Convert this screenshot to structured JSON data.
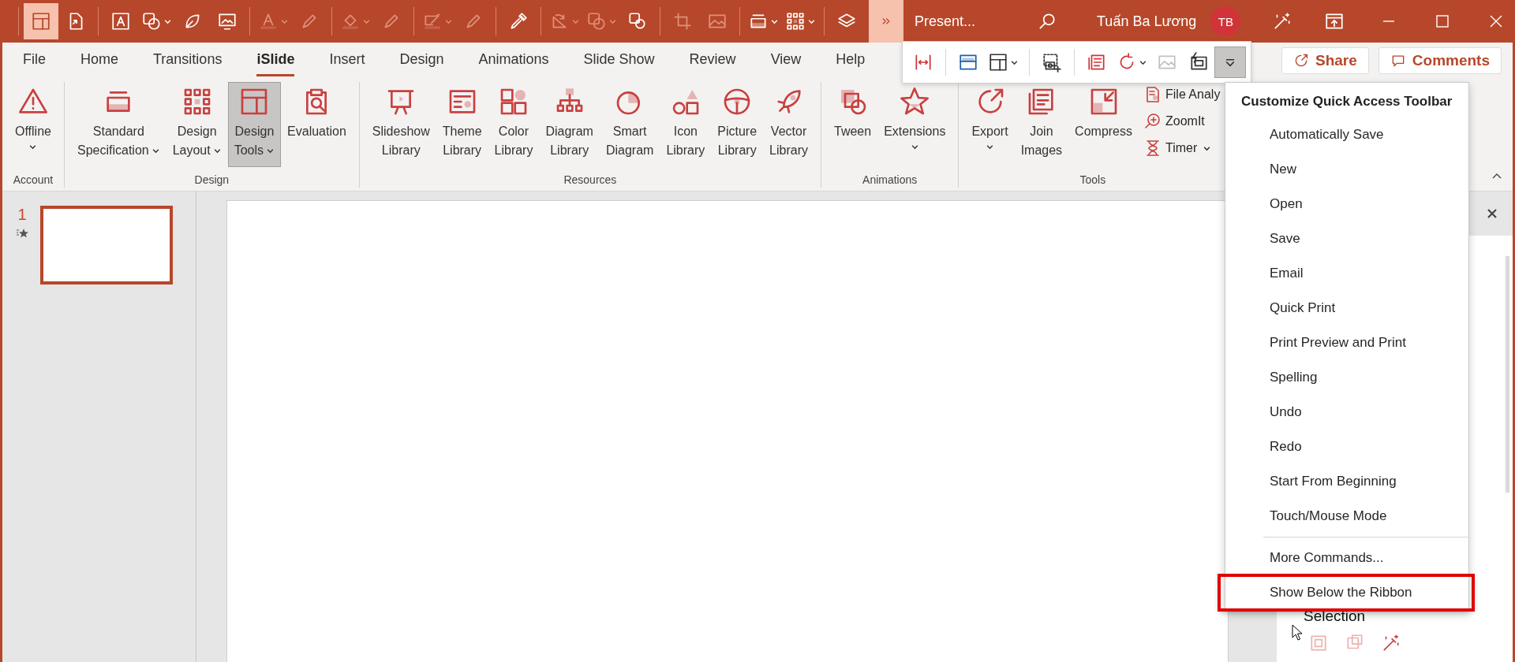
{
  "quick_access_toolbar": [
    {
      "kind": "separator"
    },
    {
      "kind": "button",
      "pressed": true,
      "disabled": false,
      "dropdown": false
    },
    {
      "kind": "button",
      "pressed": false,
      "disabled": false,
      "dropdown": false
    },
    {
      "kind": "separator"
    },
    {
      "kind": "button",
      "pressed": false,
      "disabled": false,
      "dropdown": false
    },
    {
      "kind": "button",
      "pressed": false,
      "disabled": false,
      "dropdown": true
    },
    {
      "kind": "button",
      "pressed": false,
      "disabled": false,
      "dropdown": false
    },
    {
      "kind": "button",
      "pressed": false,
      "disabled": false,
      "dropdown": false
    },
    {
      "kind": "separator"
    },
    {
      "kind": "button",
      "pressed": false,
      "disabled": true,
      "dropdown": true
    },
    {
      "kind": "button",
      "pressed": false,
      "disabled": true,
      "dropdown": false
    },
    {
      "kind": "separator"
    },
    {
      "kind": "button",
      "pressed": false,
      "disabled": true,
      "dropdown": true
    },
    {
      "kind": "button",
      "pressed": false,
      "disabled": true,
      "dropdown": false
    },
    {
      "kind": "separator"
    },
    {
      "kind": "button",
      "pressed": false,
      "disabled": true,
      "dropdown": true
    },
    {
      "kind": "button",
      "pressed": false,
      "disabled": true,
      "dropdown": false
    },
    {
      "kind": "separator"
    },
    {
      "kind": "button",
      "pressed": false,
      "disabled": false,
      "dropdown": false
    },
    {
      "kind": "separator"
    },
    {
      "kind": "button",
      "pressed": false,
      "disabled": true,
      "dropdown": true
    },
    {
      "kind": "button",
      "pressed": false,
      "disabled": true,
      "dropdown": true
    },
    {
      "kind": "button",
      "pressed": false,
      "disabled": false,
      "dropdown": false
    },
    {
      "kind": "separator"
    },
    {
      "kind": "button",
      "pressed": false,
      "disabled": true,
      "dropdown": false
    },
    {
      "kind": "button",
      "pressed": false,
      "disabled": true,
      "dropdown": false
    },
    {
      "kind": "separator"
    },
    {
      "kind": "button",
      "pressed": false,
      "disabled": false,
      "dropdown": true
    },
    {
      "kind": "button",
      "pressed": false,
      "disabled": false,
      "dropdown": true
    },
    {
      "kind": "separator"
    },
    {
      "kind": "button",
      "pressed": false,
      "disabled": false,
      "dropdown": false
    }
  ],
  "overflow_button": {
    "pressed": true
  },
  "document_title": "Present...",
  "user": {
    "name": "Tuấn Ba Lương",
    "initials": "TB"
  },
  "tabs": [
    {
      "label": "File",
      "selected": false
    },
    {
      "label": "Home",
      "selected": false
    },
    {
      "label": "Transitions",
      "selected": false
    },
    {
      "label": "iSlide",
      "selected": true
    },
    {
      "label": "Insert",
      "selected": false
    },
    {
      "label": "Design",
      "selected": false
    },
    {
      "label": "Animations",
      "selected": false
    },
    {
      "label": "Slide Show",
      "selected": false
    },
    {
      "label": "Review",
      "selected": false
    },
    {
      "label": "View",
      "selected": false
    },
    {
      "label": "Help",
      "selected": false
    }
  ],
  "share_button": "Share",
  "comments_button": "Comments",
  "ribbon_groups": [
    {
      "label": "Account",
      "buttons": [
        {
          "kind": "large",
          "lines": [
            "Offline"
          ],
          "dropdown": true,
          "pressed": false
        }
      ]
    },
    {
      "label": "Design",
      "buttons": [
        {
          "kind": "large",
          "lines": [
            "Standard",
            "Specification"
          ],
          "dropdown": true,
          "pressed": false
        },
        {
          "kind": "large",
          "lines": [
            "Design",
            "Layout"
          ],
          "dropdown": true,
          "pressed": false
        },
        {
          "kind": "large",
          "lines": [
            "Design",
            "Tools"
          ],
          "dropdown": true,
          "pressed": true
        },
        {
          "kind": "large",
          "lines": [
            "Evaluation"
          ],
          "dropdown": false,
          "pressed": false
        }
      ]
    },
    {
      "label": "Resources",
      "buttons": [
        {
          "kind": "large",
          "lines": [
            "Slideshow",
            "Library"
          ],
          "dropdown": false,
          "pressed": false
        },
        {
          "kind": "large",
          "lines": [
            "Theme",
            "Library"
          ],
          "dropdown": false,
          "pressed": false
        },
        {
          "kind": "large",
          "lines": [
            "Color",
            "Library"
          ],
          "dropdown": false,
          "pressed": false
        },
        {
          "kind": "large",
          "lines": [
            "Diagram",
            "Library"
          ],
          "dropdown": false,
          "pressed": false
        },
        {
          "kind": "large",
          "lines": [
            "Smart",
            "Diagram"
          ],
          "dropdown": false,
          "pressed": false
        },
        {
          "kind": "large",
          "lines": [
            "Icon",
            "Library"
          ],
          "dropdown": false,
          "pressed": false
        },
        {
          "kind": "large",
          "lines": [
            "Picture",
            "Library"
          ],
          "dropdown": false,
          "pressed": false
        },
        {
          "kind": "large",
          "lines": [
            "Vector",
            "Library"
          ],
          "dropdown": false,
          "pressed": false
        }
      ]
    },
    {
      "label": "Animations",
      "buttons": [
        {
          "kind": "large",
          "lines": [
            "Tween"
          ],
          "dropdown": false,
          "pressed": false
        },
        {
          "kind": "large",
          "lines": [
            "Extensions"
          ],
          "dropdown": true,
          "pressed": false
        }
      ]
    },
    {
      "label": "Tools",
      "buttons": [
        {
          "kind": "large",
          "lines": [
            "Export"
          ],
          "dropdown": true,
          "pressed": false
        },
        {
          "kind": "large",
          "lines": [
            "Join",
            "Images"
          ],
          "dropdown": false,
          "pressed": false
        },
        {
          "kind": "large",
          "lines": [
            "Compress"
          ],
          "dropdown": false,
          "pressed": false
        },
        {
          "kind": "small",
          "lines": [
            "File Analy"
          ],
          "dropdown": false,
          "pressed": false
        },
        {
          "kind": "small",
          "lines": [
            "ZoomIt"
          ],
          "dropdown": false,
          "pressed": false
        },
        {
          "kind": "small",
          "lines": [
            "Timer"
          ],
          "dropdown": true,
          "pressed": false
        }
      ]
    }
  ],
  "floating_toolbar": [
    {
      "kind": "button",
      "pressed": false,
      "disabled": false,
      "dropdown": false
    },
    {
      "kind": "separator"
    },
    {
      "kind": "button",
      "pressed": false,
      "disabled": false,
      "dropdown": false
    },
    {
      "kind": "button",
      "pressed": false,
      "disabled": false,
      "dropdown": true
    },
    {
      "kind": "separator"
    },
    {
      "kind": "button",
      "pressed": false,
      "disabled": false,
      "dropdown": false
    },
    {
      "kind": "separator"
    },
    {
      "kind": "button",
      "pressed": false,
      "disabled": false,
      "dropdown": false
    },
    {
      "kind": "button",
      "pressed": false,
      "disabled": false,
      "dropdown": true
    },
    {
      "kind": "button",
      "pressed": false,
      "disabled": true,
      "dropdown": false
    },
    {
      "kind": "button",
      "pressed": false,
      "disabled": false,
      "dropdown": false
    },
    {
      "kind": "button",
      "pressed": true,
      "disabled": false,
      "dropdown": false
    }
  ],
  "qat_menu": {
    "title": "Customize Quick Access Toolbar",
    "items": [
      {
        "label": "Automatically Save",
        "kind": "option",
        "highlighted": false
      },
      {
        "label": "New",
        "kind": "option",
        "highlighted": false
      },
      {
        "label": "Open",
        "kind": "option",
        "highlighted": false
      },
      {
        "label": "Save",
        "kind": "option",
        "highlighted": false
      },
      {
        "label": "Email",
        "kind": "option",
        "highlighted": false
      },
      {
        "label": "Quick Print",
        "kind": "option",
        "highlighted": false
      },
      {
        "label": "Print Preview and Print",
        "kind": "option",
        "highlighted": false
      },
      {
        "label": "Spelling",
        "kind": "option",
        "highlighted": false
      },
      {
        "label": "Undo",
        "kind": "option",
        "highlighted": false
      },
      {
        "label": "Redo",
        "kind": "option",
        "highlighted": false
      },
      {
        "label": "Start From Beginning",
        "kind": "option",
        "highlighted": false
      },
      {
        "label": "Touch/Mouse Mode",
        "kind": "option",
        "highlighted": false
      },
      {
        "label": "More Commands...",
        "kind": "command",
        "highlighted": false
      },
      {
        "label": "Show Below the Ribbon",
        "kind": "command",
        "highlighted": true
      }
    ]
  },
  "slides": [
    {
      "number": "1",
      "selected": true,
      "animated": true
    }
  ],
  "selection_pane": {
    "title": "Selection",
    "tools": [
      {
        "disabled": true
      },
      {
        "disabled": true
      },
      {
        "disabled": false
      }
    ]
  }
}
